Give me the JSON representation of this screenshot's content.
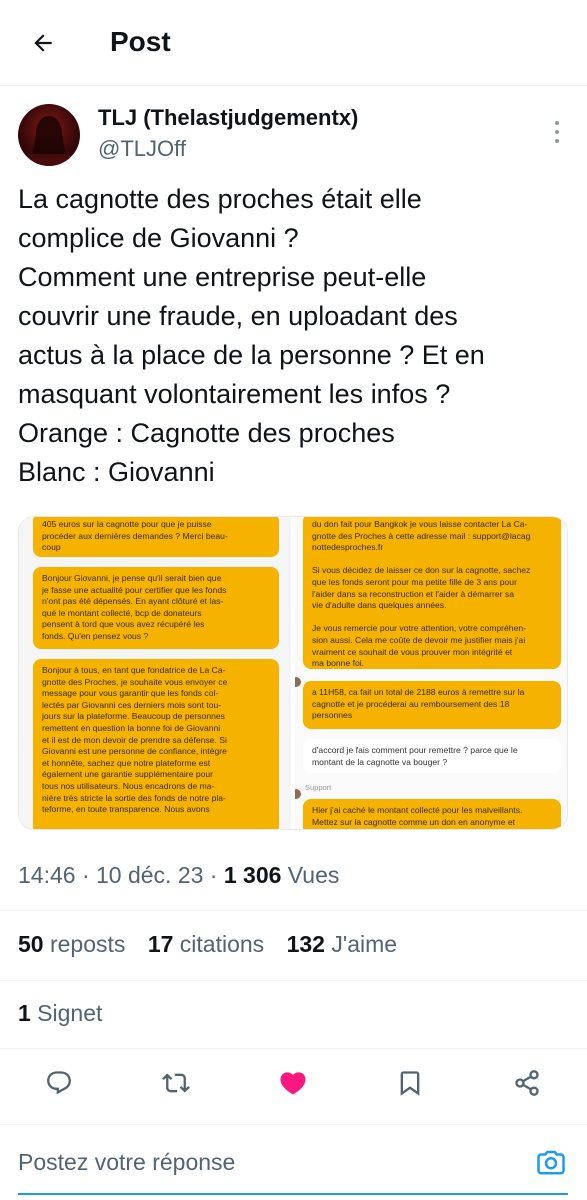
{
  "header": {
    "title": "Post"
  },
  "author": {
    "name": "TLJ (Thelastjudgementx)",
    "handle": "@TLJOff"
  },
  "tweet": {
    "lines": [
      "La cagnotte des proches était elle",
      "complice de Giovanni ?",
      "Comment une entreprise peut-elle",
      "couvrir une fraude, en uploadant des",
      "actus à la place de la personne ? Et en",
      "masquant volontairement les infos ?",
      "Orange : Cagnotte des proches",
      "Blanc : Giovanni"
    ]
  },
  "media": {
    "left_bubbles": [
      "405 euros sur la cagnotte pour que je puisse\nprocéder aux dernières demandes ? Merci beau-\ncoup",
      "Bonjour Giovanni, je pense qu'il serait bien que\nje fasse une actualité pour certifier que les fonds\nn'ont pas été dépensés. En ayant clôturé et las-\nqué le montant collecté, bcp de donateurs\npensent à tord que vous avez récupéré les\nfonds. Qu'en pensez vous ?",
      "Bonjour à tous, en tant que fondatrice de La Ca-\ngnotte des Proches, je souhaite vous envoyer ce\nmessage pour vous garantir que les fonds col-\nlectés par Giovanni ces derniers mois sont tou-\njours sur la plateforme. Beaucoup de personnes\nremettent en question la bonne foi de Giovanni\net il est de mon devoir de prendre sa défense. Si\nGiovanni est une personne de confiance, intègre\net honnête, sachez que notre plateforme est\négalement une garantie supplémentaire pour\ntous nos utilisateurs. Nous encadrons de ma-\nnière très stricte la sortie des fonds de notre pla-\nteforme, en toute transparence. Nous avons"
    ],
    "right_bubbles": [
      "du don fait pour Bangkok je vous laisse contacter La Ca-\ngnotte des Proches à cette adresse mail : support@lacag\nnottedesproches.fr\n\nSi vous décidez de laisser ce don sur la cagnotte, sachez\nque les fonds seront pour ma petite fille de 3 ans pour\nl'aider dans sa reconstruction et l'aider à démarrer sa\nvie d'adulte dans quelques années.\n\nJe vous remercie pour votre attention, votre compréhen-\nsion aussi. Cela me coûte de devoir me justifier mais j'ai\nvraiment ce souhait de vous prouver mon intégrité et\nma bonne foi.",
      "a 11H58, ca fait un total de 2188 euros à remettre sur la\ncagnotte et je procéderai au remboursement des 18\npersonnes",
      "Hier j'ai caché le montant collecté pour les malveillants.\nMettez sur la cagnotte comme un don en anonyme et"
    ],
    "right_white_bubble": "d'accord je fais comment pour remettre ? parce que le\nmontant de la cagnotte va bouger ?",
    "right_label": "Support"
  },
  "meta": {
    "time": "14:46 · 10 déc. 23 · ",
    "views_count": "1 306",
    "views_label": " Vues"
  },
  "stats": {
    "reposts_count": "50",
    "reposts_label": " reposts",
    "quotes_count": "17",
    "quotes_label": " citations",
    "likes_count": "132",
    "likes_label": " J'aime",
    "bookmarks_count": "1",
    "bookmarks_label": " Signet"
  },
  "actions": [
    "reply-icon",
    "retweet-icon",
    "heart-icon",
    "bookmark-icon",
    "share-icon"
  ],
  "reply": {
    "placeholder": "Postez votre réponse"
  },
  "colors": {
    "like": "#f91880",
    "accent": "#1d9bf0",
    "orange_bubble": "#f5b300"
  }
}
